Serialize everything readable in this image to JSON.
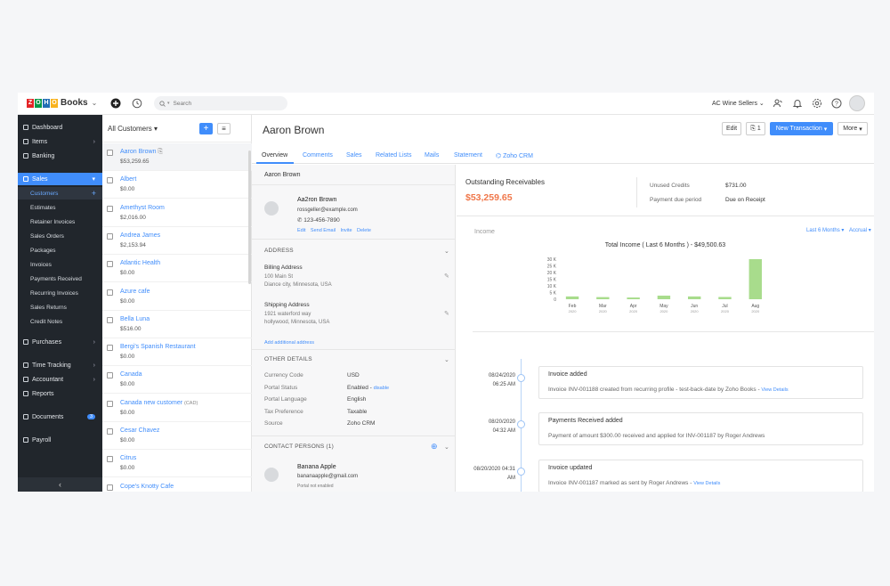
{
  "topbar": {
    "logo_letters": [
      "Z",
      "O",
      "H",
      "O"
    ],
    "logo_colors": [
      "#e42527",
      "#089949",
      "#226db4",
      "#f9b21d"
    ],
    "product": "Books",
    "search_placeholder": "Search",
    "org_name": "AC Wine Sellers",
    "icons": [
      "add-circle-icon",
      "history-icon",
      "search-icon",
      "chevron-down-icon",
      "users-icon",
      "bell-icon",
      "gear-icon",
      "help-icon",
      "avatar"
    ]
  },
  "sidebar": {
    "items": [
      {
        "label": "Dashboard"
      },
      {
        "label": "Items"
      },
      {
        "label": "Banking"
      },
      {
        "label": "Sales"
      },
      {
        "label": "Purchases"
      },
      {
        "label": "Time Tracking"
      },
      {
        "label": "Accountant"
      },
      {
        "label": "Reports"
      },
      {
        "label": "Documents",
        "badge": "3"
      },
      {
        "label": "Payroll"
      }
    ],
    "sales_sub": [
      "Customers",
      "Estimates",
      "Retainer Invoices",
      "Sales Orders",
      "Packages",
      "Invoices",
      "Payments Received",
      "Recurring Invoices",
      "Sales Returns",
      "Credit Notes"
    ]
  },
  "list": {
    "title": "All Customers",
    "customers": [
      {
        "name": "Aaron Brown",
        "amount": "$53,259.65",
        "selected": true
      },
      {
        "name": "Albert",
        "amount": "$0.00"
      },
      {
        "name": "Amethyst Room",
        "amount": "$2,016.00"
      },
      {
        "name": "Andrea James",
        "amount": "$2,153.94"
      },
      {
        "name": "Atlantic Health",
        "amount": "$0.00"
      },
      {
        "name": "Azure cafe",
        "amount": "$0.00"
      },
      {
        "name": "Bella Luna",
        "amount": "$516.00"
      },
      {
        "name": "Bergi's Spanish Restaurant",
        "amount": "$0.00"
      },
      {
        "name": "Canada",
        "amount": "$0.00"
      },
      {
        "name": "Canada new customer",
        "suffix": "(CAD)",
        "amount": "$0.00"
      },
      {
        "name": "Cesar Chavez",
        "amount": "$0.00"
      },
      {
        "name": "Citrus",
        "amount": "$0.00"
      },
      {
        "name": "Cope's Knotty Cafe",
        "amount": ""
      }
    ]
  },
  "main": {
    "title": "Aaron Brown",
    "buttons": {
      "edit": "Edit",
      "attach": "1",
      "new_txn": "New Transaction",
      "more": "More"
    },
    "tabs": [
      "Overview",
      "Comments",
      "Sales",
      "Related Lists",
      "Mails",
      "Statement",
      "Zoho CRM"
    ]
  },
  "detail": {
    "name": "Aaron Brown",
    "contact_name": "Aa2ron Brown",
    "email": "rossgeller@example.com",
    "phone": "123-456-7890",
    "actions": [
      "Edit",
      "Send Email",
      "Invite",
      "Delete"
    ],
    "address_title": "ADDRESS",
    "billing_title": "Billing Address",
    "billing_lines": [
      "100 Main St",
      "Diance city, Minnesota, USA"
    ],
    "shipping_title": "Shipping Address",
    "shipping_lines": [
      "1921 waterford way",
      "hollywood, Minnesota, USA"
    ],
    "add_address": "Add additional address",
    "other_title": "OTHER DETAILS",
    "other": [
      {
        "k": "Currency Code",
        "v": "USD"
      },
      {
        "k": "Portal Status",
        "v": "Enabled",
        "link": "disable"
      },
      {
        "k": "Portal Language",
        "v": "English"
      },
      {
        "k": "Tax Preference",
        "v": "Taxable"
      },
      {
        "k": "Source",
        "v": "Zoho CRM"
      }
    ],
    "contacts_title": "CONTACT PERSONS (1)",
    "contact2_name": "Banana Apple",
    "contact2_email": "bananaapple@gmail.com",
    "contact2_status": "Portal not enabled"
  },
  "overview": {
    "receivables_label": "Outstanding Receivables",
    "receivables_value": "$53,259.65",
    "unused_credits_label": "Unused Credits",
    "unused_credits_value": "$731.00",
    "payment_due_label": "Payment due period",
    "payment_due_value": "Due on Receipt",
    "income_label": "Income",
    "range": "Last 6 Months",
    "basis": "Accrual"
  },
  "chart_data": {
    "type": "bar",
    "title": "Total Income ( Last 6 Months ) - $49,500.63",
    "categories": [
      "Feb 2020",
      "Mar 2020",
      "Apr 2020",
      "May 2020",
      "Jun 2020",
      "Jul 2020",
      "Aug 2020"
    ],
    "cat_month": [
      "Feb",
      "Mar",
      "Apr",
      "May",
      "Jun",
      "Jul",
      "Aug"
    ],
    "cat_year": [
      "2020",
      "2020",
      "2020",
      "2020",
      "2020",
      "2020",
      "2020"
    ],
    "values": [
      2100,
      1600,
      1300,
      2700,
      2100,
      1700,
      30000
    ],
    "yticks": [
      "30 K",
      "25 K",
      "20 K",
      "15 K",
      "10 K",
      "5 K",
      "0"
    ],
    "ylim": [
      0,
      30000
    ],
    "bar_color": "#a8dc8c"
  },
  "timeline": [
    {
      "date": "08/24/2020",
      "time": "06:25 AM",
      "title": "Invoice added",
      "body": "Invoice INV-001188 created from recurring profile - test-back-date by Zoho Books - ",
      "link": "View Details"
    },
    {
      "date": "08/20/2020",
      "time": "04:32 AM",
      "title": "Payments Received added",
      "body": "Payment of amount $300.00 received and applied for INV-001187 by Roger Andrews",
      "link": ""
    },
    {
      "date": "08/20/2020 04:31",
      "time": "AM",
      "title": "Invoice updated",
      "body": "Invoice INV-001187 marked as sent by Roger Andrews - ",
      "link": "View Details"
    }
  ]
}
